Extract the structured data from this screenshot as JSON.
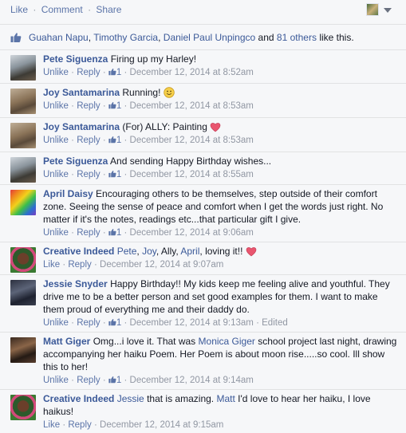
{
  "top_actions": {
    "like": "Like",
    "comment": "Comment",
    "share": "Share",
    "sep": "·"
  },
  "likes": {
    "names": [
      "Guahan Napu",
      "Timothy Garcia",
      "Daniel Paul Unpingco"
    ],
    "comma": ",",
    "and": "and",
    "others": "81 others",
    "suffix": "like this."
  },
  "labels": {
    "unlike": "Unlike",
    "like": "Like",
    "reply": "Reply",
    "dot": "·"
  },
  "comments": [
    {
      "author": "Pete Siguenza",
      "text": "Firing up my Harley!",
      "like_action": "Unlike",
      "like_count": "1",
      "time": "December 12, 2014 at 8:52am"
    },
    {
      "author": "Joy Santamarina",
      "text": "Running!",
      "like_action": "Unlike",
      "like_count": "1",
      "time": "December 12, 2014 at 8:53am"
    },
    {
      "author": "Joy Santamarina",
      "text": "(For) ALLY: Painting",
      "like_action": "Unlike",
      "like_count": "1",
      "time": "December 12, 2014 at 8:53am"
    },
    {
      "author": "Pete Siguenza",
      "text": "And sending Happy Birthday wishes...",
      "like_action": "Unlike",
      "like_count": "1",
      "time": "December 12, 2014 at 8:55am"
    },
    {
      "author": "April Daisy",
      "text": "Encouraging others to be themselves, step outside of their comfort zone. Seeing the sense of peace and comfort when I get the words just right. No matter if it's the notes, readings etc...that particular gift I give.",
      "like_action": "Unlike",
      "like_count": "1",
      "time": "December 12, 2014 at 9:06am"
    },
    {
      "author": "Creative Indeed",
      "mentions": [
        "Pete",
        "Joy"
      ],
      "plain": "Ally,",
      "mention2": "April",
      "text": "loving it!!",
      "like_action": "Like",
      "time": "December 12, 2014 at 9:07am"
    },
    {
      "author": "Jessie Snyder",
      "text": "Happy Birthday!! My kids keep me feeling alive and youthful. They drive me to be a better person and set good examples for them. I want to make them proud of everything me and their daddy do.",
      "like_action": "Unlike",
      "like_count": "1",
      "time": "December 12, 2014 at 9:13am",
      "edited": "Edited"
    },
    {
      "author": "Matt Giger",
      "text_before": "Omg...i love it. That was",
      "mention": "Monica Giger",
      "text_after": "school project last night, drawing accompanying her haiku Poem. Her Poem is about moon rise.....so cool. Ill show this to her!",
      "like_action": "Unlike",
      "like_count": "1",
      "time": "December 12, 2014 at 9:14am"
    },
    {
      "author": "Creative Indeed",
      "mention": "Jessie",
      "text_mid": "that is amazing.",
      "mention2": "Matt",
      "text_after": "I'd love to hear her haiku, I love haikus!",
      "like_action": "Like",
      "time": "December 12, 2014 at 9:15am"
    }
  ],
  "colors": {
    "link": "#3b5998",
    "meta": "#9197a3",
    "heart": "#e9566f",
    "background": "#f6f7f9"
  },
  "icons": {
    "thumb": "thumbs-up-icon",
    "heart": "heart-emoticon",
    "smiley": "smiley-emoticon",
    "caret": "chevron-down-icon"
  }
}
